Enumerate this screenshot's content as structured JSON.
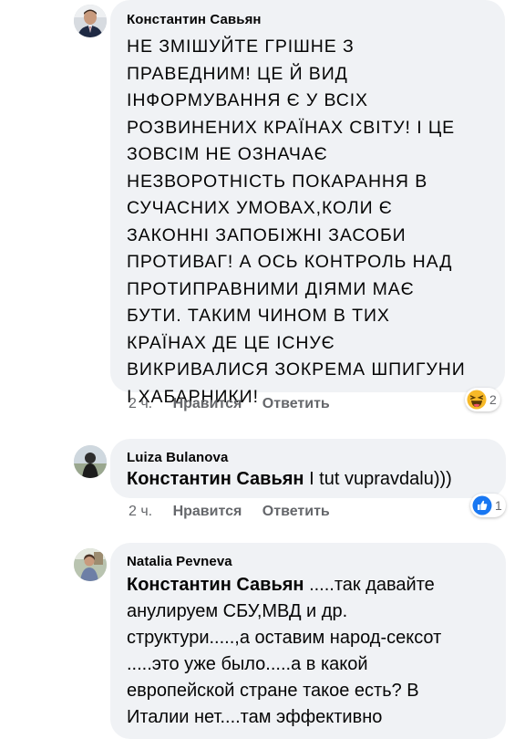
{
  "comments": [
    {
      "author": "Константин Савьян",
      "lines": [
        "НЕ ЗМІШУЙТЕ ГРІШНЕ З",
        "ПРАВЕДНИМ! ЦЕ Й ВИД",
        "ІНФОРМУВАННЯ Є У ВСІХ",
        "РОЗВИНЕНИХ КРАЇНАХ СВІТУ! І ЦЕ",
        "ЗОВСІМ НЕ ОЗНАЧАЄ",
        "НЕЗВОРОТНІСТЬ ПОКАРАННЯ В",
        "СУЧАСНИХ УМОВАХ,КОЛИ Є",
        "ЗАКОННІ ЗАПОБІЖНІ ЗАСОБИ",
        "ПРОТИВАГ! А ОСЬ КОНТРОЛЬ НАД",
        "ПРОТИПРАВНИМИ ДІЯМИ МАЄ",
        "БУТИ. ТАКИМ ЧИНОМ В ТИХ",
        "КРАЇНАХ ДЕ ЦЕ ІСНУЄ",
        "ВИКРИВАЛИСЯ ЗОКРЕМА ШПИГУНИ",
        "І ХАБАРНИКИ!"
      ],
      "time": "2 ч.",
      "like_label": "Нравится",
      "reply_label": "Ответить",
      "reaction": {
        "icon": "haha-emoji-icon",
        "count": "2",
        "color": "#f7b928"
      }
    },
    {
      "author": "Luiza Bulanova",
      "mention": "Константин Савьян",
      "text_rest": " I tut vupravdalu)))",
      "time": "2 ч.",
      "like_label": "Нравится",
      "reply_label": "Ответить",
      "reaction": {
        "icon": "like-thumb-icon",
        "count": "1",
        "color": "#1877f2"
      }
    },
    {
      "author": "Natalia Pevneva",
      "mention": "Константин Савьян",
      "first_line_rest": " .....так давайте",
      "lines": [
        "анулируем СБУ,МВД и др.",
        "структури.....,а оставим народ-сексот",
        ".....это уже было.....а в какой",
        "европейской стране такое есть?  В",
        "Италии нет....там эффективно"
      ]
    }
  ]
}
